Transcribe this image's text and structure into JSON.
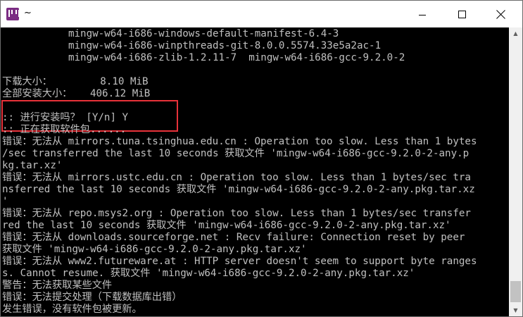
{
  "window": {
    "title": "~",
    "minimize_symbol": "",
    "close_symbol": ""
  },
  "console": {
    "lines": [
      "           mingw-w64-i686-windows-default-manifest-6.4-3",
      "           mingw-w64-i686-winpthreads-git-8.0.0.5574.33e5a2ac-1",
      "           mingw-w64-i686-zlib-1.2.11-7  mingw-w64-i686-gcc-9.2.0-2",
      "",
      "下载大小：        8.10 MiB",
      "全部安装大小：   406.12 MiB",
      "",
      ":: 进行安装吗？ [Y/n] Y",
      ":: 正在获取软件包......",
      "错误：无法从 mirrors.tuna.tsinghua.edu.cn : Operation too slow. Less than 1 bytes",
      "/sec transferred the last 10 seconds 获取文件 'mingw-w64-i686-gcc-9.2.0-2-any.p",
      "kg.tar.xz'",
      "错误：无法从 mirrors.ustc.edu.cn : Operation too slow. Less than 1 bytes/sec tra",
      "nsferred the last 10 seconds 获取文件 'mingw-w64-i686-gcc-9.2.0-2-any.pkg.tar.xz",
      "'",
      "错误：无法从 repo.msys2.org : Operation too slow. Less than 1 bytes/sec transfer",
      "red the last 10 seconds 获取文件 'mingw-w64-i686-gcc-9.2.0-2-any.pkg.tar.xz'",
      "错误：无法从 downloads.sourceforge.net : Recv failure: Connection reset by peer",
      "获取文件 'mingw-w64-i686-gcc-9.2.0-2-any.pkg.tar.xz'",
      "错误：无法从 www2.futureware.at : HTTP server doesn't seem to support byte ranges",
      "s. Cannot resume. 获取文件 'mingw-w64-i686-gcc-9.2.0-2-any.pkg.tar.xz'",
      "警告：无法获取某些文件",
      "错误：无法提交处理（下载数据库出错）",
      "发生错误，没有软件包被更新。"
    ]
  },
  "colors": {
    "background": "#000000",
    "text": "#c0c0c0",
    "highlight_border": "#e8323a"
  },
  "icons": {
    "app": "msys2-icon",
    "minimize": "minimize-icon",
    "maximize": "maximize-icon",
    "close": "close-icon"
  }
}
